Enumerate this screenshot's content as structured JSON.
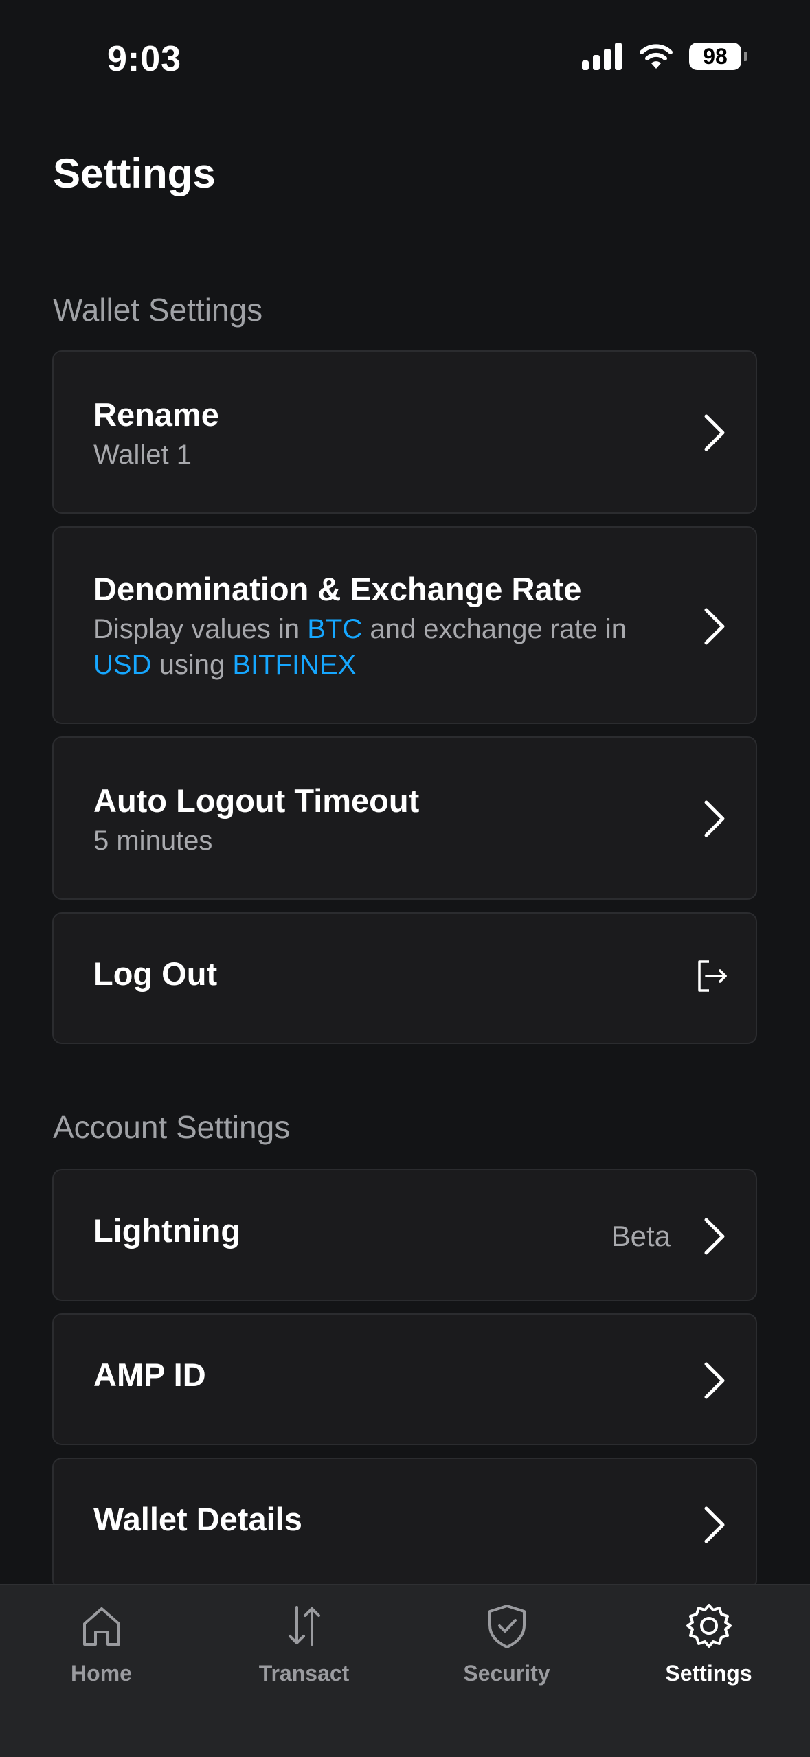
{
  "status_bar": {
    "time": "9:03",
    "battery": "98"
  },
  "page": {
    "title": "Settings"
  },
  "wallet_settings": {
    "section_title": "Wallet Settings",
    "rename": {
      "title": "Rename",
      "value": "Wallet 1"
    },
    "denomination": {
      "title": "Denomination & Exchange Rate",
      "text_1": "Display values in ",
      "currency": "BTC",
      "text_2": " and exchange rate in ",
      "fiat": "USD",
      "text_3": " using ",
      "source": "BITFINEX"
    },
    "auto_logout": {
      "title": "Auto Logout Timeout",
      "value": "5 minutes"
    },
    "logout": {
      "title": "Log Out"
    }
  },
  "account_settings": {
    "section_title": "Account Settings",
    "lightning": {
      "title": "Lightning",
      "badge": "Beta"
    },
    "amp_id": {
      "title": "AMP ID"
    },
    "wallet_details": {
      "title": "Wallet Details"
    }
  },
  "tabs": [
    {
      "label": "Home",
      "icon": "home-icon"
    },
    {
      "label": "Transact",
      "icon": "transact-icon"
    },
    {
      "label": "Security",
      "icon": "shield-icon"
    },
    {
      "label": "Settings",
      "icon": "gear-icon",
      "active": true
    }
  ],
  "colors": {
    "background": "#131416",
    "card": "#1b1b1d",
    "accent": "#16a7ff",
    "tab_bar": "#242527"
  }
}
